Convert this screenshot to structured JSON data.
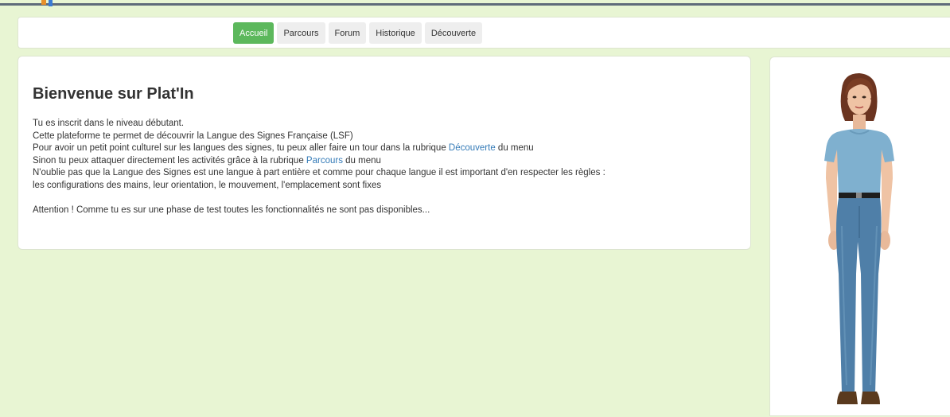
{
  "nav": {
    "items": [
      {
        "label": "Accueil",
        "active": true
      },
      {
        "label": "Parcours",
        "active": false
      },
      {
        "label": "Forum",
        "active": false
      },
      {
        "label": "Historique",
        "active": false
      },
      {
        "label": "Découverte",
        "active": false
      }
    ]
  },
  "welcome": {
    "title": "Bienvenue sur Plat'In",
    "line1": "Tu es inscrit dans le niveau débutant.",
    "line2": "Cette plateforme te permet de découvrir la Langue des Signes Française (LSF)",
    "line3_pre": "Pour avoir un petit point culturel sur les langues des signes, tu peux aller faire un tour dans la rubrique ",
    "line3_link": "Découverte",
    "line3_post": " du menu",
    "line4_pre": "Sinon tu peux attaquer directement les activités grâce à la rubrique ",
    "line4_link": "Parcours",
    "line4_post": " du menu",
    "line5": "N'oublie pas que la Langue des Signes est une langue à part entière et comme pour chaque langue il est important d'en respecter les règles :",
    "line6": "les configurations des mains, leur orientation, le mouvement, l'emplacement sont fixes",
    "line7": "Attention ! Comme tu es sur une phase de test toutes les fonctionnalités ne sont pas disponibles..."
  },
  "colors": {
    "page_background": "#e8f5d3",
    "active_nav": "#5cb85c",
    "link": "#337ab7"
  },
  "avatar": {
    "icon": "signing-avatar-woman"
  }
}
